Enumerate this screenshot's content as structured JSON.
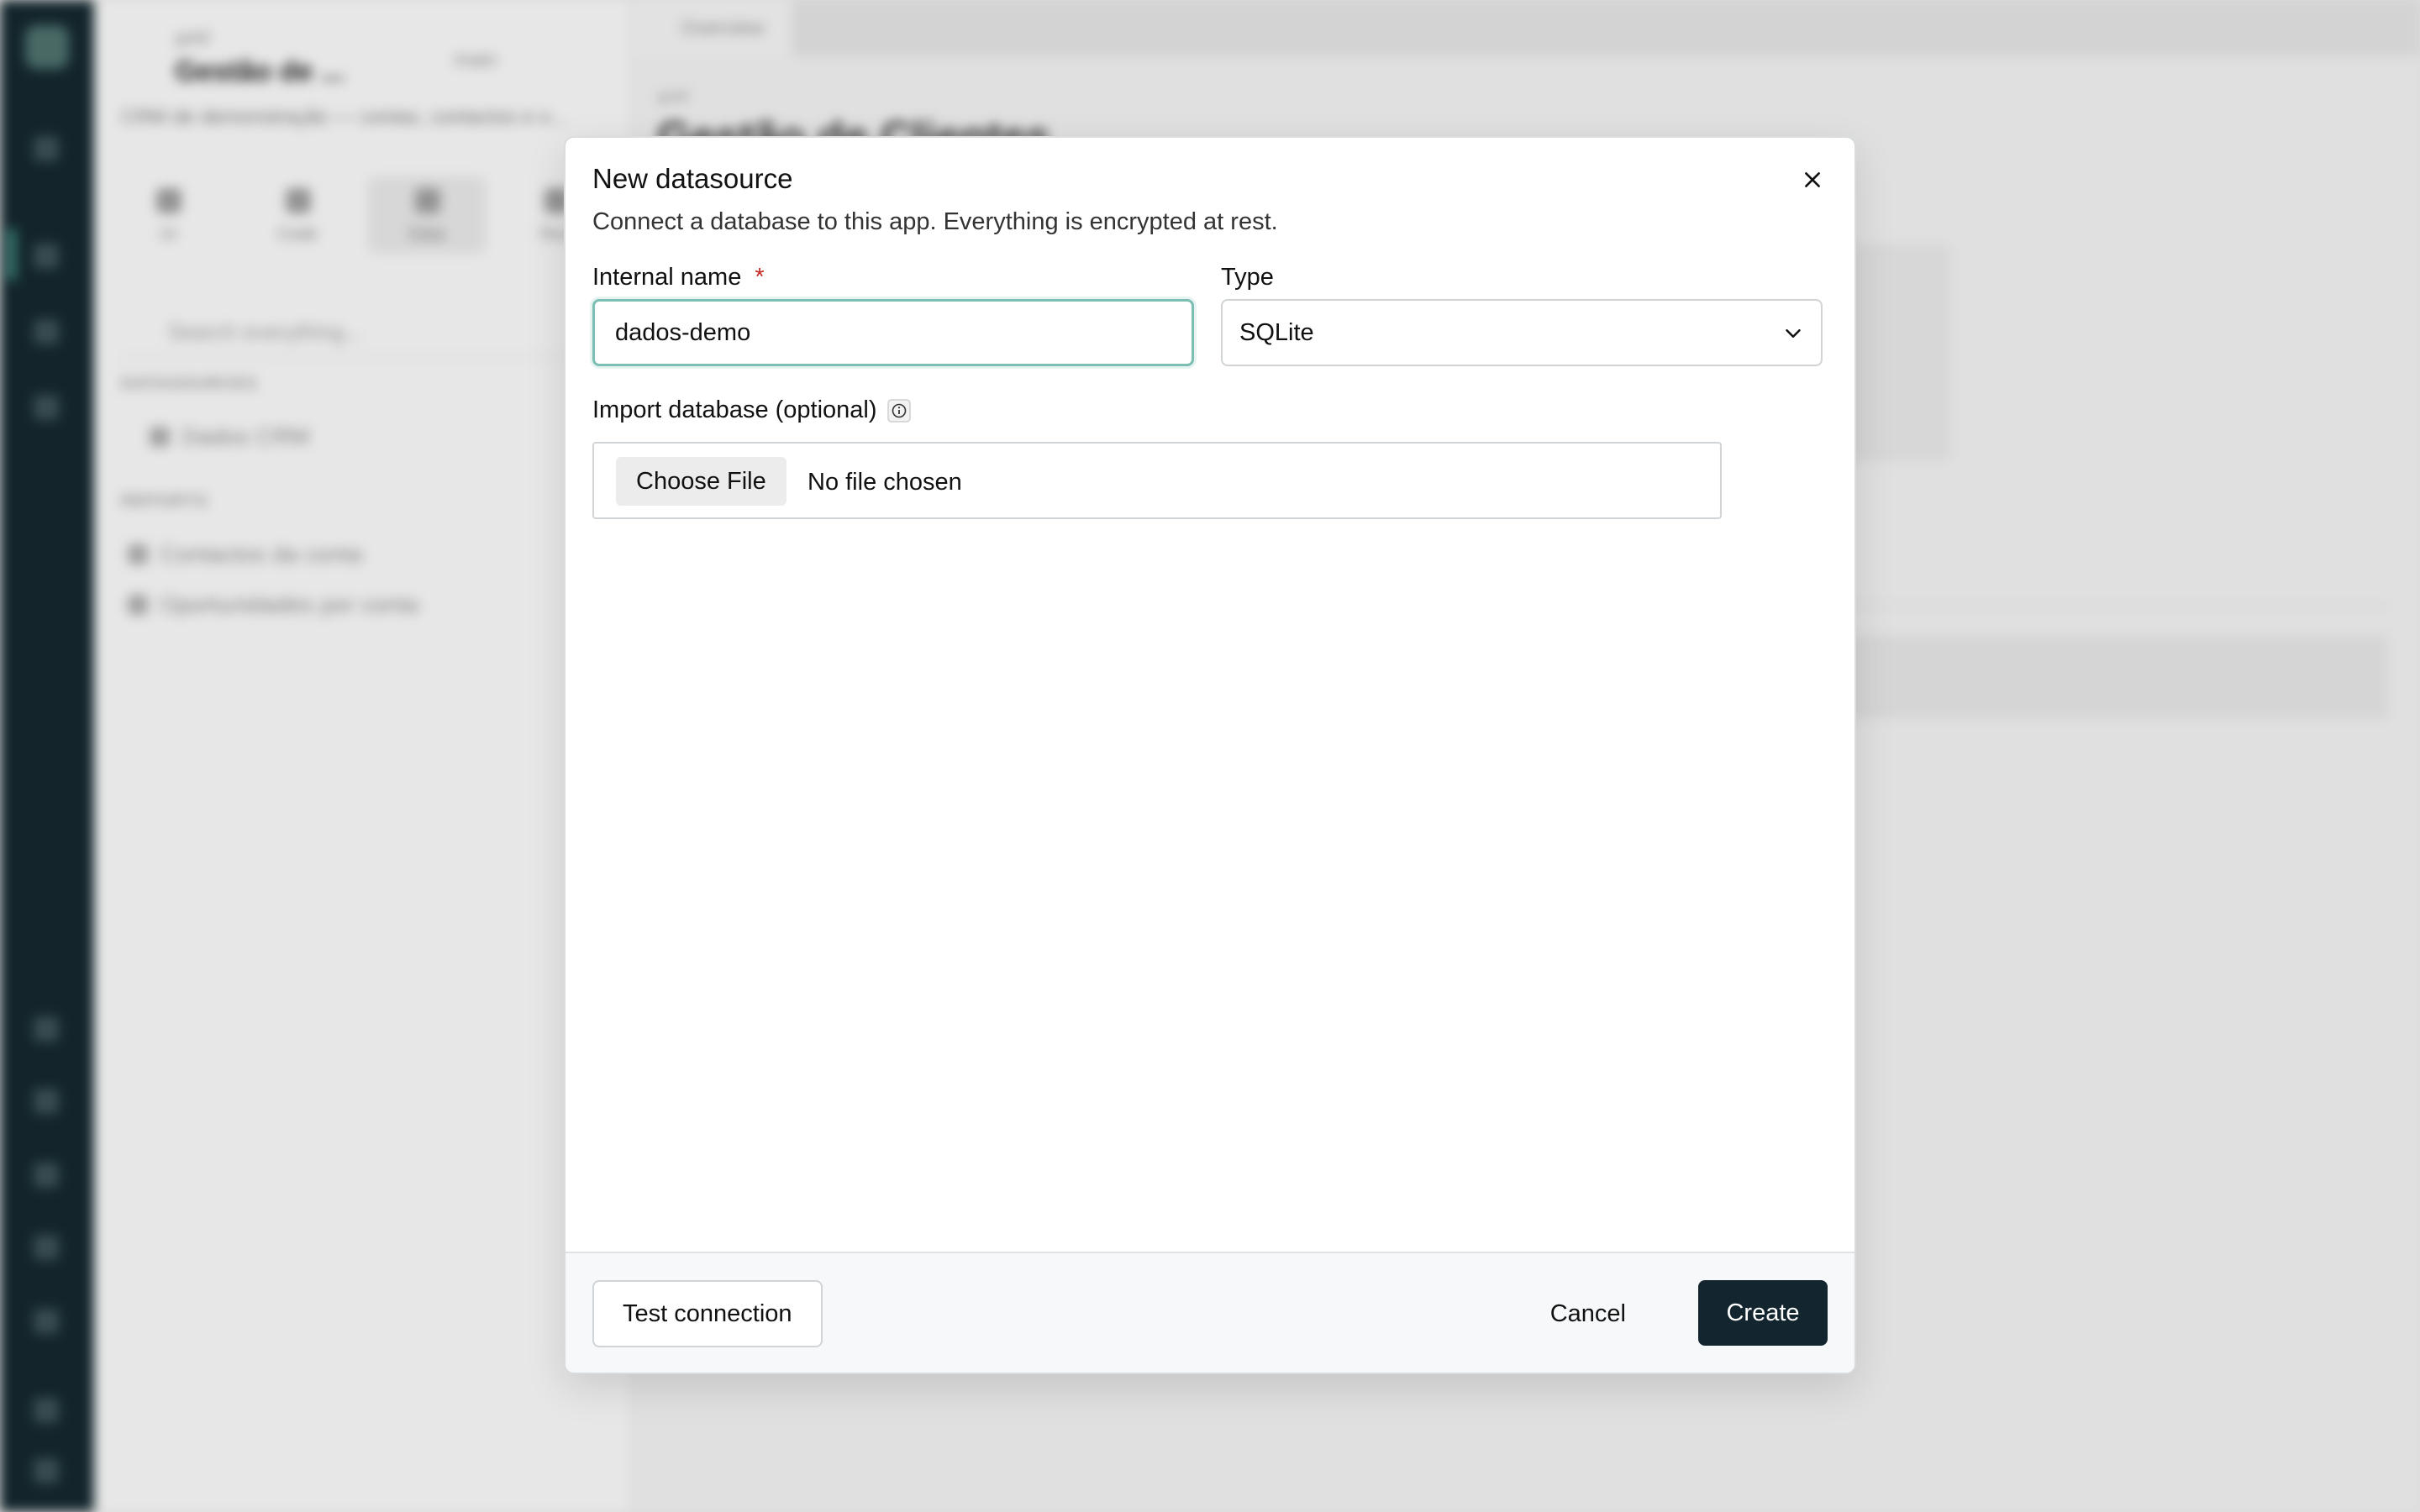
{
  "background": {
    "panel": {
      "app_label": "gold",
      "app_title": "Gestão de ...",
      "branch": "main",
      "description": "CRM de demonstração — contas, contactos e o...",
      "tabs": [
        "UI",
        "Code",
        "Data",
        "Run"
      ],
      "search_placeholder": "Search everything...",
      "datasources_heading": "DATASOURCES",
      "datasources": [
        "Dados CRM"
      ],
      "reports_heading": "REPORTS",
      "reports": [
        "Contactos da conta",
        "Oportunidades por conta"
      ]
    },
    "main": {
      "tab": "Overview",
      "crumb": "gold",
      "title": "Gestão de Clientes"
    }
  },
  "modal": {
    "title": "New datasource",
    "description": "Connect a database to this app. Everything is encrypted at rest.",
    "internal_name": {
      "label": "Internal name",
      "required_mark": "*",
      "value": "dados-demo"
    },
    "type": {
      "label": "Type",
      "value": "SQLite"
    },
    "import": {
      "label": "Import database (optional)",
      "button": "Choose File",
      "status": "No file chosen"
    },
    "footer": {
      "test_label": "Test connection",
      "cancel_label": "Cancel",
      "create_label": "Create"
    }
  },
  "icons": {
    "close": "close-icon",
    "chevron": "chevron-down-icon",
    "info": "info-icon"
  },
  "colors": {
    "primary_button": "#13252e",
    "focus_ring": "#7cbdb4",
    "required": "#c62828",
    "rail": "#14272d"
  }
}
